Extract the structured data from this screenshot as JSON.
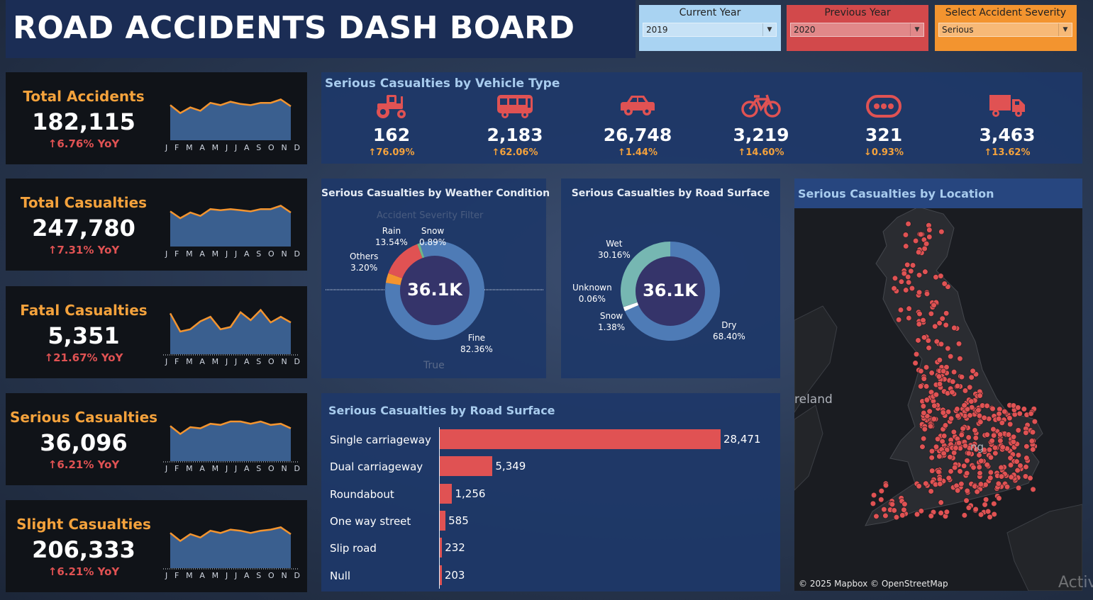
{
  "header": {
    "title": "ROAD ACCIDENTS DASH BOARD"
  },
  "filters": [
    {
      "label": "Current Year",
      "value": "2019",
      "color": "#a9d3f2"
    },
    {
      "label": "Previous Year",
      "value": "2020",
      "color": "#d2494b"
    },
    {
      "label": "Select Accident Severity",
      "value": "Serious",
      "color": "#f3942f"
    }
  ],
  "kpis": [
    {
      "label": "Total Accidents",
      "value": "182,115",
      "yoy": "↑6.76% YoY",
      "trend": [
        0.62,
        0.48,
        0.58,
        0.52,
        0.66,
        0.62,
        0.68,
        0.64,
        0.62,
        0.66,
        0.66,
        0.72,
        0.6
      ]
    },
    {
      "label": "Total Casualties",
      "value": "247,780",
      "yoy": "↑7.31% YoY",
      "trend": [
        0.62,
        0.5,
        0.6,
        0.54,
        0.66,
        0.64,
        0.66,
        0.64,
        0.62,
        0.66,
        0.66,
        0.72,
        0.6
      ]
    },
    {
      "label": "Fatal Casualties",
      "value": "5,351",
      "yoy": "↑21.67% YoY",
      "trend": [
        0.72,
        0.4,
        0.44,
        0.58,
        0.66,
        0.44,
        0.48,
        0.74,
        0.6,
        0.78,
        0.56,
        0.66,
        0.56
      ]
    },
    {
      "label": "Serious Casualties",
      "value": "36,096",
      "yoy": "↑6.21% YoY",
      "trend": [
        0.62,
        0.48,
        0.6,
        0.58,
        0.66,
        0.64,
        0.7,
        0.7,
        0.66,
        0.7,
        0.64,
        0.66,
        0.58
      ]
    },
    {
      "label": "Slight Casualties",
      "value": "206,333",
      "yoy": "↑6.21% YoY",
      "trend": [
        0.62,
        0.48,
        0.6,
        0.54,
        0.66,
        0.62,
        0.68,
        0.66,
        0.62,
        0.66,
        0.68,
        0.72,
        0.6
      ]
    }
  ],
  "months": [
    "J",
    "F",
    "M",
    "A",
    "M",
    "J",
    "J",
    "A",
    "S",
    "O",
    "N",
    "D"
  ],
  "vehicle": {
    "title": "Serious Casualties by Vehicle Type",
    "items": [
      {
        "icon": "tractor-icon",
        "value": "162",
        "change": "↑76.09%"
      },
      {
        "icon": "bus-icon",
        "value": "2,183",
        "change": "↑62.06%"
      },
      {
        "icon": "car-icon",
        "value": "26,748",
        "change": "↑1.44%"
      },
      {
        "icon": "bicycle-icon",
        "value": "3,219",
        "change": "↑14.60%"
      },
      {
        "icon": "other-vehicle-icon",
        "value": "321",
        "change": "↓0.93%"
      },
      {
        "icon": "truck-icon",
        "value": "3,463",
        "change": "↑13.62%"
      }
    ]
  },
  "weather": {
    "title": "Serious Casualties by Weather Condition",
    "center": "36.1K",
    "overlay_text": "Accident Severity Filter",
    "footer": "True",
    "slices": [
      {
        "name": "Fine",
        "pct": "82.36%",
        "value": 82.36,
        "color": "#4e7bb6"
      },
      {
        "name": "Others",
        "pct": "3.20%",
        "value": 3.2,
        "color": "#f3942f"
      },
      {
        "name": "Rain",
        "pct": "13.54%",
        "value": 13.54,
        "color": "#e05253"
      },
      {
        "name": "Snow",
        "pct": "0.89%",
        "value": 0.89,
        "color": "#6fb58a"
      }
    ]
  },
  "surface": {
    "title": "Serious  Casualties by Road Surface",
    "center": "36.1K",
    "slices": [
      {
        "name": "Dry",
        "pct": "68.40%",
        "value": 68.4,
        "color": "#4e7bb6"
      },
      {
        "name": "Snow",
        "pct": "1.38%",
        "value": 1.38,
        "color": "#ffffff"
      },
      {
        "name": "Unknown",
        "pct": "0.06%",
        "value": 0.06,
        "color": "#9aa4b8"
      },
      {
        "name": "Wet",
        "pct": "30.16%",
        "value": 30.16,
        "color": "#76b7b2"
      }
    ]
  },
  "location": {
    "title": "Serious Casualties by Location",
    "attribution": "© 2025 Mapbox © OpenStreetMap",
    "map_label": "reland",
    "map_label2": "ng",
    "watermark": "Activ"
  },
  "road": {
    "title": "Serious Casualties by Road Surface",
    "bar_color": "#e05253"
  },
  "chart_data": {
    "type": "bar",
    "orientation": "horizontal",
    "title": "Serious Casualties by Road Surface",
    "categories": [
      "Single carriageway",
      "Dual carriageway",
      "Roundabout",
      "One way street",
      "Slip road",
      "Null"
    ],
    "values": [
      28471,
      5349,
      1256,
      585,
      232,
      203
    ],
    "labels": [
      "28,471",
      "5,349",
      "1,256",
      "585",
      "232",
      "203"
    ]
  }
}
